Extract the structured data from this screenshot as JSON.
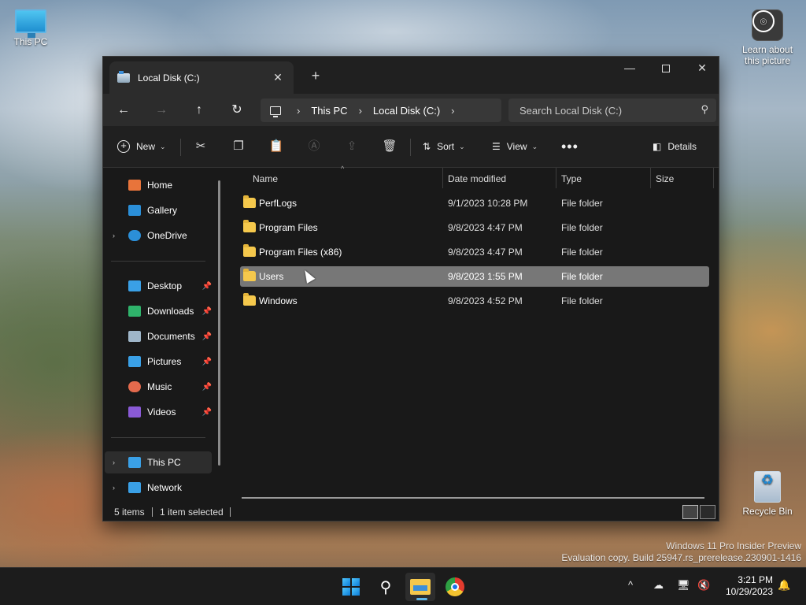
{
  "desktop": {
    "this_pc_label": "This PC",
    "learn_label": "Learn about this picture",
    "recycle_label": "Recycle Bin"
  },
  "watermark": {
    "line1": "Windows 11 Pro Insider Preview",
    "line2": "Evaluation copy. Build 25947.rs_prerelease.230901-1416"
  },
  "window": {
    "tab_title": "Local Disk (C:)",
    "tab_close": "✕",
    "new_tab": "+",
    "minimize": "—",
    "close": "✕"
  },
  "address": {
    "back": "←",
    "forward": "→",
    "up": "↑",
    "refresh": "↻",
    "crumbs": [
      "This PC",
      "Local Disk (C:)"
    ],
    "sep": "›",
    "search_placeholder": "Search Local Disk (C:)",
    "search_icon": "⚲"
  },
  "toolbar": {
    "new_label": "New",
    "cut_icon": "✂",
    "copy_icon": "❐",
    "paste_icon": "📋",
    "rename_icon": "Ⓐ",
    "share_icon": "⇪",
    "delete_icon": "🗑",
    "sort_label": "Sort",
    "view_label": "View",
    "more_label": "•••",
    "details_label": "Details",
    "chevron": "⌄"
  },
  "sidebar": {
    "items": [
      {
        "label": "Home",
        "color": "#e8743b"
      },
      {
        "label": "Gallery",
        "color": "#2b8fd8"
      },
      {
        "label": "OneDrive",
        "color": "#2b8fd8"
      },
      {
        "label": "Desktop",
        "color": "#3aa0e6"
      },
      {
        "label": "Downloads",
        "color": "#2fb36b"
      },
      {
        "label": "Documents",
        "color": "#9fb6c9"
      },
      {
        "label": "Pictures",
        "color": "#3aa0e6"
      },
      {
        "label": "Music",
        "color": "#e36a4d"
      },
      {
        "label": "Videos",
        "color": "#8a5ad6"
      },
      {
        "label": "This PC",
        "color": "#3aa0e6"
      },
      {
        "label": "Network",
        "color": "#3aa0e6"
      }
    ],
    "expander": "›",
    "pin": "📌"
  },
  "columns": {
    "name": "Name",
    "date": "Date modified",
    "type": "Type",
    "size": "Size",
    "sort_caret": "^"
  },
  "files": [
    {
      "name": "PerfLogs",
      "date": "9/1/2023 10:28 PM",
      "type": "File folder"
    },
    {
      "name": "Program Files",
      "date": "9/8/2023 4:47 PM",
      "type": "File folder"
    },
    {
      "name": "Program Files (x86)",
      "date": "9/8/2023 4:47 PM",
      "type": "File folder"
    },
    {
      "name": "Users",
      "date": "9/8/2023 1:55 PM",
      "type": "File folder"
    },
    {
      "name": "Windows",
      "date": "9/8/2023 4:52 PM",
      "type": "File folder"
    }
  ],
  "status": {
    "count": "5 items",
    "selected": "1 item selected"
  },
  "taskbar": {
    "search_icon": "⚲",
    "tray_chevron": "^",
    "tray_icons": [
      "☁",
      "🖥",
      "🔇"
    ],
    "time": "3:21 PM",
    "date": "10/29/2023",
    "bell": "🔔"
  },
  "colors": {
    "accent": "#5fb6e6",
    "folder": "#f5c84c",
    "selection": "#777777"
  }
}
